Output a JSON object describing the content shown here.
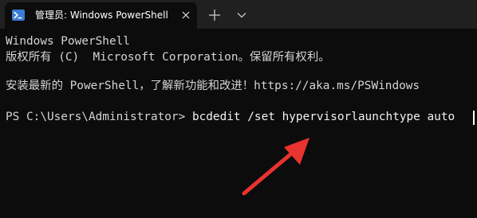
{
  "window": {
    "tab_title": "管理员: Windows PowerShell",
    "tab_icon": "powershell-icon",
    "close_icon": "close-icon",
    "new_tab_icon": "plus-icon",
    "dropdown_icon": "chevron-down-icon"
  },
  "terminal": {
    "lines": [
      "Windows PowerShell",
      "版权所有 (C)  Microsoft Corporation。保留所有权利。",
      "安装最新的 PowerShell，了解新功能和改进！https://aka.ms/PSWindows"
    ],
    "prompt": "PS C:\\Users\\Administrator> ",
    "command": "bcdedit /set hypervisorlaunchtype auto"
  },
  "annotation": {
    "arrow_icon": "red-arrow-icon",
    "color": "#e8332e"
  },
  "colors": {
    "background": "#0c0c0c",
    "titlebar": "#202020",
    "text": "#d4d4d4"
  }
}
